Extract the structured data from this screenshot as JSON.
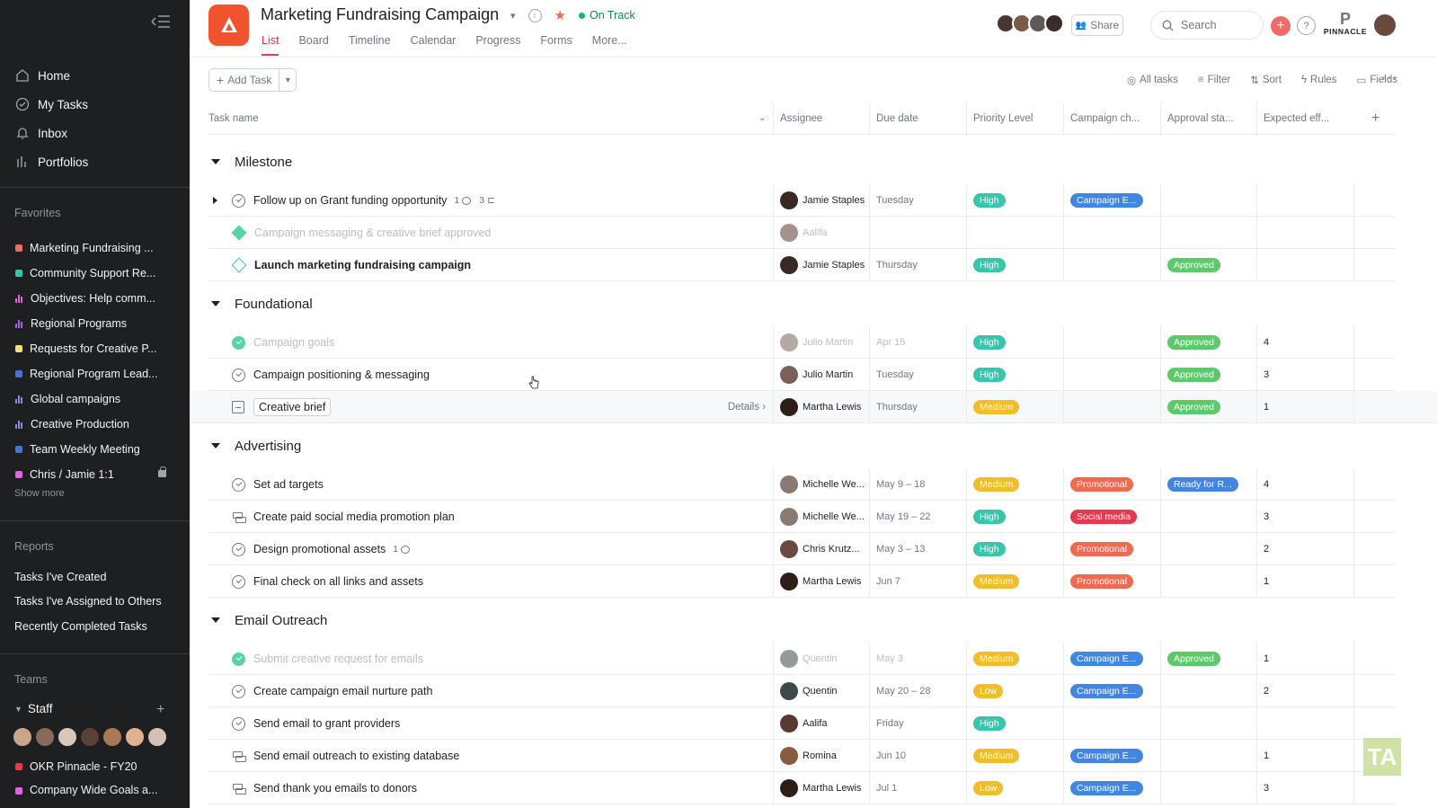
{
  "sidebar": {
    "nav": [
      {
        "label": "Home",
        "icon": "home-icon"
      },
      {
        "label": "My Tasks",
        "icon": "check-circle-icon"
      },
      {
        "label": "Inbox",
        "icon": "bell-icon"
      },
      {
        "label": "Portfolios",
        "icon": "bar-chart-icon"
      }
    ],
    "favorites_label": "Favorites",
    "favorites": [
      {
        "label": "Marketing Fundraising ...",
        "color": "#f06a6a",
        "kind": "dot"
      },
      {
        "label": "Community Support Re...",
        "color": "#37c5ab",
        "kind": "dot"
      },
      {
        "label": "Objectives: Help comm...",
        "color": "#e362e3",
        "kind": "bars"
      },
      {
        "label": "Regional Programs",
        "color": "#aa62e3",
        "kind": "bars"
      },
      {
        "label": "Requests for Creative P...",
        "color": "#f8df72",
        "kind": "dot"
      },
      {
        "label": "Regional Program Lead...",
        "color": "#4573d2",
        "kind": "dot"
      },
      {
        "label": "Global campaigns",
        "color": "#8d84e8",
        "kind": "bars"
      },
      {
        "label": "Creative Production",
        "color": "#8d84e8",
        "kind": "bars"
      },
      {
        "label": "Team Weekly Meeting",
        "color": "#4573d2",
        "kind": "dot"
      },
      {
        "label": "Chris / Jamie 1:1",
        "color": "#e362e3",
        "kind": "dot"
      }
    ],
    "show_more": "Show more",
    "reports_label": "Reports",
    "reports": [
      "Tasks I've Created",
      "Tasks I've Assigned to Others",
      "Recently Completed Tasks"
    ],
    "teams_label": "Teams",
    "team_name": "Staff",
    "team_project": {
      "label": "OKR Pinnacle - FY20",
      "color": "#e8384f"
    },
    "team_project_2": {
      "label": "Company Wide Goals a...",
      "color": "#e362e3"
    }
  },
  "header": {
    "title": "Marketing Fundraising Campaign",
    "status": "On Track",
    "tabs": [
      "List",
      "Board",
      "Timeline",
      "Calendar",
      "Progress",
      "Forms",
      "More..."
    ],
    "active_tab": "List",
    "share": "Share",
    "search_placeholder": "Search",
    "org_name": "PINNACLE",
    "org_letter": "P"
  },
  "toolbar": {
    "add_task": "Add Task",
    "all_tasks": "All tasks",
    "filter": "Filter",
    "sort": "Sort",
    "rules": "Rules",
    "fields": "Fields"
  },
  "columns": [
    "Task name",
    "Assignee",
    "Due date",
    "Priority Level",
    "Campaign ch...",
    "Approval sta...",
    "Expected eff..."
  ],
  "colors": {
    "High": "#37c5ab",
    "Medium": "#f1bd2a",
    "Low": "#f1bd2a",
    "Campaign E...": "#4186e0",
    "Promotional": "#f06a4f",
    "Social media": "#e8384f",
    "Approved": "#5cc96b",
    "Ready for R...": "#4186e0"
  },
  "sections": [
    {
      "name": "Milestone",
      "tasks": [
        {
          "name": "Follow up on Grant funding opportunity",
          "type": "task",
          "expand": true,
          "comments": "1",
          "subtasks": "3",
          "assignee": "Jamie Staples",
          "due": "Tuesday",
          "priority": "High",
          "campaign": "Campaign E...",
          "approval": "",
          "effort": ""
        },
        {
          "name": "Campaign messaging & creative brief approved",
          "type": "milestone",
          "done": true,
          "assignee": "Aalifa",
          "due": "",
          "priority": "",
          "campaign": "",
          "approval": "",
          "effort": ""
        },
        {
          "name": "Launch marketing fundraising campaign",
          "type": "milestone",
          "bold": true,
          "assignee": "Jamie Staples",
          "due": "Thursday",
          "priority": "High",
          "campaign": "",
          "approval": "Approved",
          "effort": ""
        }
      ]
    },
    {
      "name": "Foundational",
      "tasks": [
        {
          "name": "Campaign goals",
          "type": "task",
          "done": true,
          "assignee": "Julio Martin",
          "due": "Apr 15",
          "priority": "High",
          "campaign": "",
          "approval": "Approved",
          "effort": "4"
        },
        {
          "name": "Campaign positioning & messaging",
          "type": "task",
          "assignee": "Julio Martin",
          "due": "Tuesday",
          "priority": "High",
          "campaign": "",
          "approval": "Approved",
          "effort": "3"
        },
        {
          "name": "Creative brief",
          "type": "approval",
          "editing": true,
          "details": "Details",
          "assignee": "Martha Lewis",
          "due": "Thursday",
          "priority": "Medium",
          "campaign": "",
          "approval": "Approved",
          "effort": "1"
        }
      ]
    },
    {
      "name": "Advertising",
      "tasks": [
        {
          "name": "Set ad targets",
          "type": "task",
          "assignee": "Michelle We...",
          "due": "May 9 – 18",
          "priority": "Medium",
          "campaign": "Promotional",
          "approval": "Ready for R...",
          "effort": "4"
        },
        {
          "name": "Create paid social media promotion plan",
          "type": "subtask",
          "assignee": "Michelle We...",
          "due": "May 19 – 22",
          "priority": "High",
          "campaign": "Social media",
          "approval": "",
          "effort": "3"
        },
        {
          "name": "Design promotional assets",
          "type": "task",
          "comments": "1",
          "assignee": "Chris Krutz...",
          "due": "May 3 – 13",
          "priority": "High",
          "campaign": "Promotional",
          "approval": "",
          "effort": "2"
        },
        {
          "name": "Final check on all links and assets",
          "type": "task",
          "assignee": "Martha Lewis",
          "due": "Jun 7",
          "priority": "Medium",
          "campaign": "Promotional",
          "approval": "",
          "effort": "1"
        }
      ]
    },
    {
      "name": "Email Outreach",
      "tasks": [
        {
          "name": "Submit creative request for emails",
          "type": "task",
          "done": true,
          "assignee": "Quentin",
          "due": "May 3",
          "priority": "Medium",
          "campaign": "Campaign E...",
          "approval": "Approved",
          "effort": "1"
        },
        {
          "name": "Create campaign email nurture path",
          "type": "task",
          "assignee": "Quentin",
          "due": "May 20 – 28",
          "priority": "Low",
          "campaign": "Campaign E...",
          "approval": "",
          "effort": "2"
        },
        {
          "name": "Send email to grant providers",
          "type": "task",
          "assignee": "Aalifa",
          "due": "Friday",
          "priority": "High",
          "campaign": "",
          "approval": "",
          "effort": ""
        },
        {
          "name": "Send email outreach to existing database",
          "type": "subtask",
          "assignee": "Romina",
          "due": "Jun 10",
          "priority": "Medium",
          "campaign": "Campaign E...",
          "approval": "",
          "effort": "1"
        },
        {
          "name": "Send thank you emails to donors",
          "type": "subtask",
          "assignee": "Martha Lewis",
          "due": "Jul 1",
          "priority": "Low",
          "campaign": "Campaign E...",
          "approval": "",
          "effort": "3"
        }
      ]
    }
  ],
  "watermark": "TA"
}
